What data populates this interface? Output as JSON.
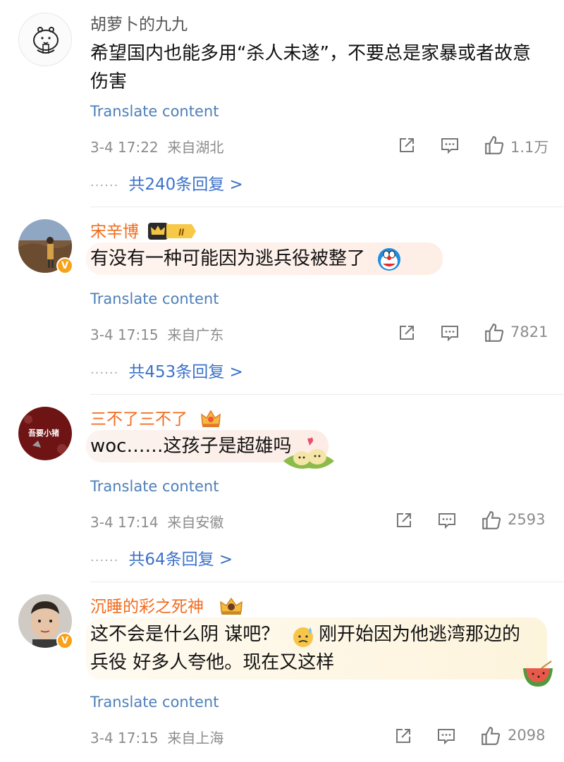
{
  "translate_label": "Translate content",
  "comments": [
    {
      "username": "胡萝卜的九九",
      "text_line1": "希望国内也能多用“杀人未遂”，不要总是家暴或者故意",
      "text_line2": "伤害",
      "time": "3-4 17:22",
      "location": "来自湖北",
      "likes": "1.1万",
      "replies_prefix": "共",
      "replies_count": "240",
      "replies_suffix": "条回复 >"
    },
    {
      "username": "宋辛博",
      "level_badge": "II",
      "text_line1": "有没有一种可能因为逃兵役被整了",
      "time": "3-4 17:15",
      "location": "来自广东",
      "likes": "7821",
      "replies_prefix": "共",
      "replies_count": "453",
      "replies_suffix": "条回复 >"
    },
    {
      "username": "三不了三不了",
      "avatar_text": "吾要小猪",
      "text_line1": "woc……这孩子是超雄吗",
      "time": "3-4 17:14",
      "location": "来自安徽",
      "likes": "2593",
      "replies_prefix": "共",
      "replies_count": "64",
      "replies_suffix": "条回复 >"
    },
    {
      "username": "沉睡的彩之死神",
      "text_line1a": "这不会是什么阴 谋吧？",
      "text_line1b": "刚开始因为他逃湾那边的",
      "text_line2": "兵役 好多人夸他。现在又这样",
      "time": "3-4 17:15",
      "location": "来自上海",
      "likes": "2098"
    }
  ],
  "icons": [
    "share-icon",
    "comment-icon",
    "like-icon",
    "verified-icon",
    "crown-icon"
  ],
  "colors": {
    "vip_name": "#f26b1d",
    "link": "#4d7fb8",
    "reply_link": "#3c72c9",
    "meta": "#8c8c8c"
  }
}
